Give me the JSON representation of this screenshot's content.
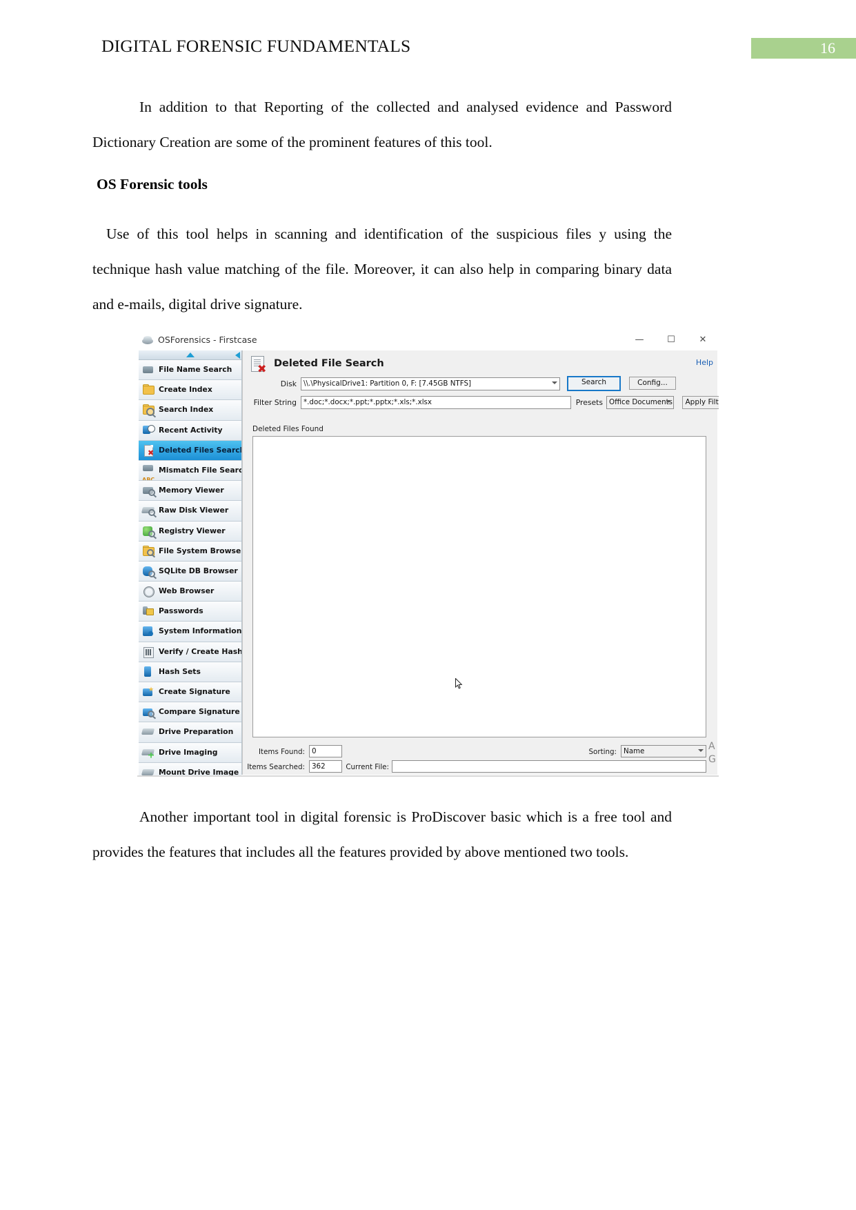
{
  "document": {
    "header_title": "DIGITAL FORENSIC FUNDAMENTALS",
    "page_number": "16",
    "badge_color": "#a9d18e",
    "paragraph_1": "In addition to that Reporting of the collected and analysed evidence and Password Dictionary Creation are some of the prominent features of this tool.",
    "heading_os_tools": "OS Forensic tools",
    "paragraph_2": "Use of this tool helps in scanning and identification of the suspicious files y using the technique hash value matching of the file. Moreover, it can also help in comparing binary data and e-mails, digital drive signature.",
    "paragraph_3": "Another important tool in digital forensic is ProDiscover basic which is a free tool and provides the features that includes all the features provided by above mentioned two tools."
  },
  "app": {
    "window_title": "OSForensics - Firstcase",
    "window_controls": {
      "minimize": "—",
      "maximize": "☐",
      "close": "✕"
    },
    "sidebar": {
      "scroll_up": "scroll-up-arrow",
      "scroll_down": "scroll-down-arrow",
      "items": [
        {
          "label": "File Name Search",
          "icon": "binoculars-icon",
          "selected": false
        },
        {
          "label": "Create Index",
          "icon": "folder-index-icon",
          "selected": false
        },
        {
          "label": "Search Index",
          "icon": "magnifier-folder-icon",
          "selected": false
        },
        {
          "label": "Recent Activity",
          "icon": "clock-history-icon",
          "selected": false
        },
        {
          "label": "Deleted Files Search",
          "icon": "deleted-file-icon",
          "selected": true
        },
        {
          "label": "Mismatch File Search",
          "icon": "abc-mismatch-icon",
          "selected": false
        },
        {
          "label": "Memory Viewer",
          "icon": "memory-chip-icon",
          "selected": false
        },
        {
          "label": "Raw Disk Viewer",
          "icon": "raw-disk-icon",
          "selected": false
        },
        {
          "label": "Registry Viewer",
          "icon": "registry-green-icon",
          "selected": false
        },
        {
          "label": "File System Browser",
          "icon": "folder-browse-icon",
          "selected": false
        },
        {
          "label": "SQLite DB Browser",
          "icon": "database-icon",
          "selected": false
        },
        {
          "label": "Web Browser",
          "icon": "web-globe-icon",
          "selected": false
        },
        {
          "label": "Passwords",
          "icon": "lock-key-icon",
          "selected": false
        },
        {
          "label": "System Information",
          "icon": "system-info-icon",
          "selected": false
        },
        {
          "label": "Verify / Create Hash",
          "icon": "hash-bars-icon",
          "selected": false
        },
        {
          "label": "Hash Sets",
          "icon": "hash-sets-icon",
          "selected": false
        },
        {
          "label": "Create Signature",
          "icon": "create-signature-icon",
          "selected": false
        },
        {
          "label": "Compare Signature",
          "icon": "compare-signature-icon",
          "selected": false
        },
        {
          "label": "Drive Preparation",
          "icon": "drive-prep-icon",
          "selected": false
        },
        {
          "label": "Drive Imaging",
          "icon": "drive-imaging-icon",
          "selected": false
        },
        {
          "label": "Mount Drive Image",
          "icon": "mount-drive-icon",
          "selected": false
        }
      ]
    },
    "panel": {
      "title": "Deleted File Search",
      "title_icon": "deleted-file-icon",
      "help_link": "Help",
      "disk_label": "Disk",
      "disk_value": "\\\\.\\PhysicalDrive1: Partition 0, F: [7.45GB NTFS]",
      "search_button": "Search",
      "config_button": "Config...",
      "filter_label": "Filter String",
      "filter_value": "*.doc;*.docx;*.ppt;*.pptx;*.xls;*.xlsx",
      "presets_label": "Presets",
      "presets_value": "Office Documents",
      "apply_filter_button": "Apply Filter",
      "results_label": "Deleted Files Found",
      "status": {
        "items_found_label": "Items Found:",
        "items_found_value": "0",
        "items_searched_label": "Items Searched:",
        "items_searched_value": "362",
        "current_file_label": "Current File:",
        "current_file_value": "",
        "sorting_label": "Sorting:",
        "sorting_value": "Name"
      },
      "edge_letters": "A\nG"
    }
  }
}
